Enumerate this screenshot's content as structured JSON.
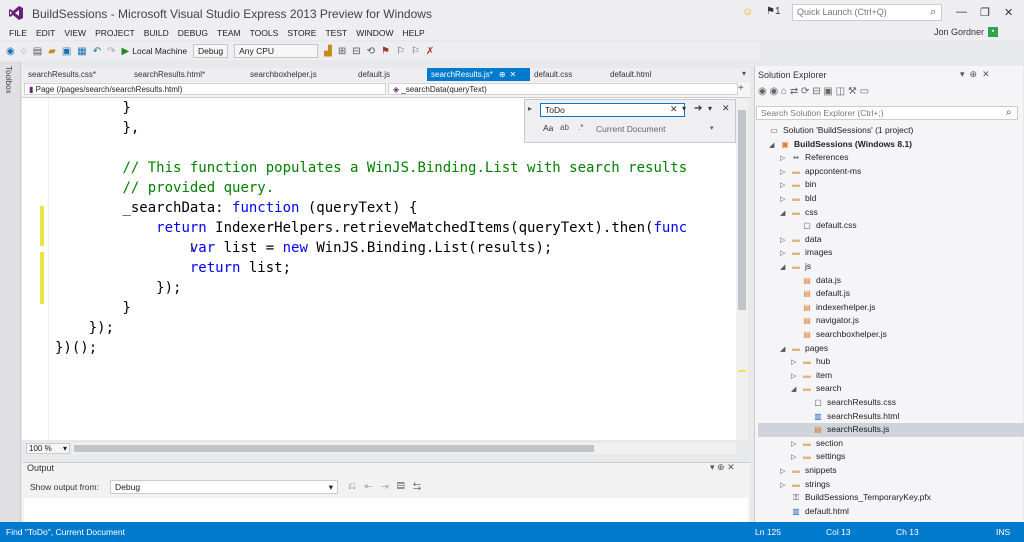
{
  "window": {
    "title": "BuildSessions - Microsoft Visual Studio Express 2013 Preview for Windows",
    "notifications_count": "1",
    "quick_launch_placeholder": "Quick Launch (Ctrl+Q)"
  },
  "menu": [
    "FILE",
    "EDIT",
    "VIEW",
    "PROJECT",
    "BUILD",
    "DEBUG",
    "TEAM",
    "TOOLS",
    "STORE",
    "TEST",
    "WINDOW",
    "HELP"
  ],
  "user": {
    "name": "Jon Gordner"
  },
  "toolbar": {
    "run_target": "Local Machine",
    "configuration": "Debug",
    "platform": "Any CPU"
  },
  "side_strip": {
    "toolbox_label": "Toolbox"
  },
  "tabs": [
    {
      "label": "searchResults.css*"
    },
    {
      "label": "searchResults.html*"
    },
    {
      "label": "searchboxhelper.js"
    },
    {
      "label": "default.js"
    },
    {
      "label": "searchResults.js*",
      "active": true
    },
    {
      "label": "default.css"
    },
    {
      "label": "default.html"
    }
  ],
  "navbar": {
    "scope": "Page (/pages/search/searchResults.html)",
    "member": "_searchData(queryText)"
  },
  "code_lines": [
    {
      "pre": "        ",
      "parts": [
        {
          "t": "}",
          "c": ""
        }
      ]
    },
    {
      "pre": "        ",
      "parts": [
        {
          "t": "},",
          "c": ""
        }
      ]
    },
    {
      "pre": "",
      "parts": [
        {
          "t": "",
          "c": ""
        }
      ]
    },
    {
      "pre": "        ",
      "parts": [
        {
          "t": "// This function populates a WinJS.Binding.List with search results",
          "c": "cm"
        }
      ]
    },
    {
      "pre": "        ",
      "parts": [
        {
          "t": "// provided query.",
          "c": "cm"
        }
      ]
    },
    {
      "pre": "        ",
      "parts": [
        {
          "t": "_searchData: ",
          "c": ""
        },
        {
          "t": "function",
          "c": "kw"
        },
        {
          "t": " (queryText) {",
          "c": ""
        }
      ]
    },
    {
      "pre": "            ",
      "parts": [
        {
          "t": "return",
          "c": "kw"
        },
        {
          "t": " IndexerHelpers.retrieveMatchedItems(queryText).then(",
          "c": ""
        },
        {
          "t": "func",
          "c": "kw"
        }
      ]
    },
    {
      "pre": "                ",
      "parts": [
        {
          "t": "var",
          "c": "kw"
        },
        {
          "t": " list = ",
          "c": ""
        },
        {
          "t": "new",
          "c": "kw"
        },
        {
          "t": " WinJS.Binding.List(results);",
          "c": ""
        }
      ]
    },
    {
      "pre": "                ",
      "parts": [
        {
          "t": "return",
          "c": "kw"
        },
        {
          "t": " list;",
          "c": ""
        }
      ]
    },
    {
      "pre": "            ",
      "parts": [
        {
          "t": "});",
          "c": ""
        }
      ]
    },
    {
      "pre": "        ",
      "parts": [
        {
          "t": "}",
          "c": ""
        }
      ]
    },
    {
      "pre": "    ",
      "parts": [
        {
          "t": "});",
          "c": ""
        }
      ]
    },
    {
      "pre": "",
      "parts": [
        {
          "t": "})();",
          "c": ""
        }
      ]
    }
  ],
  "find": {
    "query": "ToDo",
    "options_label": "Aa",
    "scope": "Current Document"
  },
  "editor_zoom": "100 %",
  "output": {
    "title": "Output",
    "show_from_label": "Show output from:",
    "source": "Debug"
  },
  "solution_explorer": {
    "title": "Solution Explorer",
    "search_placeholder": "Search Solution Explorer (Ctrl+;)",
    "tree": [
      {
        "label": "Solution 'BuildSessions' (1 project)",
        "depth": 0,
        "icon": "solution",
        "arrow": ""
      },
      {
        "label": "BuildSessions (Windows 8.1)",
        "depth": 1,
        "icon": "project",
        "arrow": "open",
        "bold": true
      },
      {
        "label": "References",
        "depth": 2,
        "icon": "references",
        "arrow": "closed"
      },
      {
        "label": "appcontent-ms",
        "depth": 2,
        "icon": "folder",
        "arrow": "closed"
      },
      {
        "label": "bin",
        "depth": 2,
        "icon": "folder",
        "arrow": "closed"
      },
      {
        "label": "bld",
        "depth": 2,
        "icon": "folder",
        "arrow": "closed"
      },
      {
        "label": "css",
        "depth": 2,
        "icon": "folder",
        "arrow": "open"
      },
      {
        "label": "default.css",
        "depth": 3,
        "icon": "css",
        "arrow": ""
      },
      {
        "label": "data",
        "depth": 2,
        "icon": "folder",
        "arrow": "closed"
      },
      {
        "label": "images",
        "depth": 2,
        "icon": "folder",
        "arrow": "closed"
      },
      {
        "label": "js",
        "depth": 2,
        "icon": "folder",
        "arrow": "open"
      },
      {
        "label": "data.js",
        "depth": 3,
        "icon": "js",
        "arrow": ""
      },
      {
        "label": "default.js",
        "depth": 3,
        "icon": "js",
        "arrow": ""
      },
      {
        "label": "indexerhelper.js",
        "depth": 3,
        "icon": "js",
        "arrow": ""
      },
      {
        "label": "navigator.js",
        "depth": 3,
        "icon": "js",
        "arrow": ""
      },
      {
        "label": "searchboxhelper.js",
        "depth": 3,
        "icon": "js",
        "arrow": ""
      },
      {
        "label": "pages",
        "depth": 2,
        "icon": "folder",
        "arrow": "open"
      },
      {
        "label": "hub",
        "depth": 3,
        "icon": "folder",
        "arrow": "closed"
      },
      {
        "label": "item",
        "depth": 3,
        "icon": "folder",
        "arrow": "closed"
      },
      {
        "label": "search",
        "depth": 3,
        "icon": "folder",
        "arrow": "open"
      },
      {
        "label": "searchResults.css",
        "depth": 4,
        "icon": "css",
        "arrow": ""
      },
      {
        "label": "searchResults.html",
        "depth": 4,
        "icon": "html",
        "arrow": ""
      },
      {
        "label": "searchResults.js",
        "depth": 4,
        "icon": "js",
        "arrow": "",
        "selected": true
      },
      {
        "label": "section",
        "depth": 3,
        "icon": "folder",
        "arrow": "closed"
      },
      {
        "label": "settings",
        "depth": 3,
        "icon": "folder",
        "arrow": "closed"
      },
      {
        "label": "snippets",
        "depth": 2,
        "icon": "folder",
        "arrow": "closed"
      },
      {
        "label": "strings",
        "depth": 2,
        "icon": "folder",
        "arrow": "closed"
      },
      {
        "label": "BuildSessions_TemporaryKey.pfx",
        "depth": 2,
        "icon": "key",
        "arrow": ""
      },
      {
        "label": "default.html",
        "depth": 2,
        "icon": "html",
        "arrow": ""
      }
    ]
  },
  "status": {
    "message": "Find \"ToDo\", Current Document",
    "line": "Ln 125",
    "col": "Col 13",
    "ch": "Ch 13",
    "mode": "INS"
  },
  "colors": {
    "accent": "#007acc",
    "keyword": "#0000ff",
    "comment": "#008000",
    "change_marker": "#efe34a"
  }
}
